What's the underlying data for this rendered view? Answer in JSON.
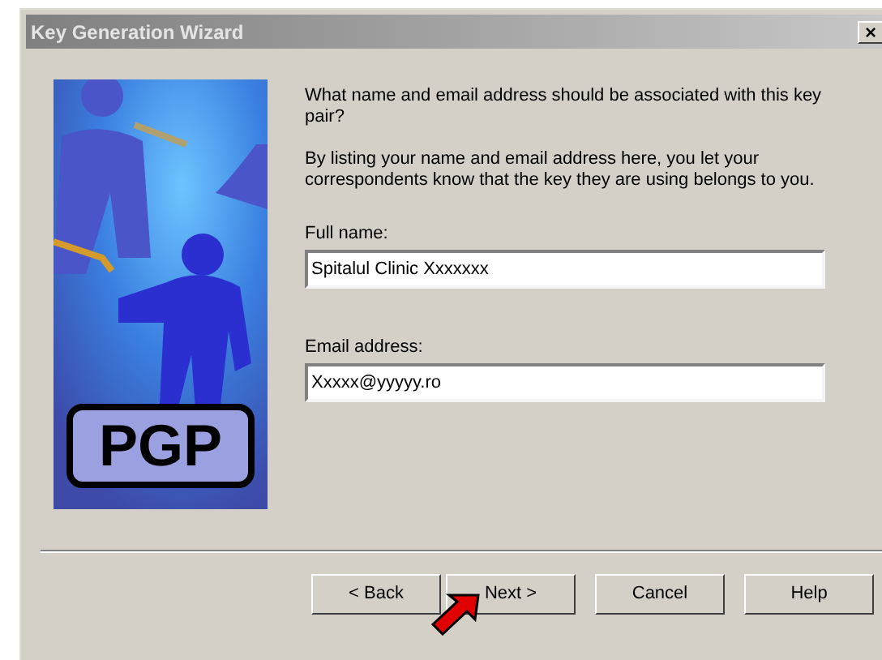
{
  "window": {
    "title": "Key Generation Wizard",
    "close": "×"
  },
  "logo": {
    "text": "PGP"
  },
  "question": "What name and email address should be associated with this key pair?",
  "explanation": "By listing your name and email address here, you let your correspondents know that the key they are using belongs to you.",
  "fields": [
    {
      "label": "Full name:",
      "value": "Spitalul Clinic Xxxxxxx"
    },
    {
      "label": "Email address:",
      "value": "Xxxxx@yyyyy.ro"
    }
  ],
  "buttons": [
    {
      "label": "< Back"
    },
    {
      "label": "Next >"
    },
    {
      "label": "Cancel"
    },
    {
      "label": "Help"
    }
  ]
}
